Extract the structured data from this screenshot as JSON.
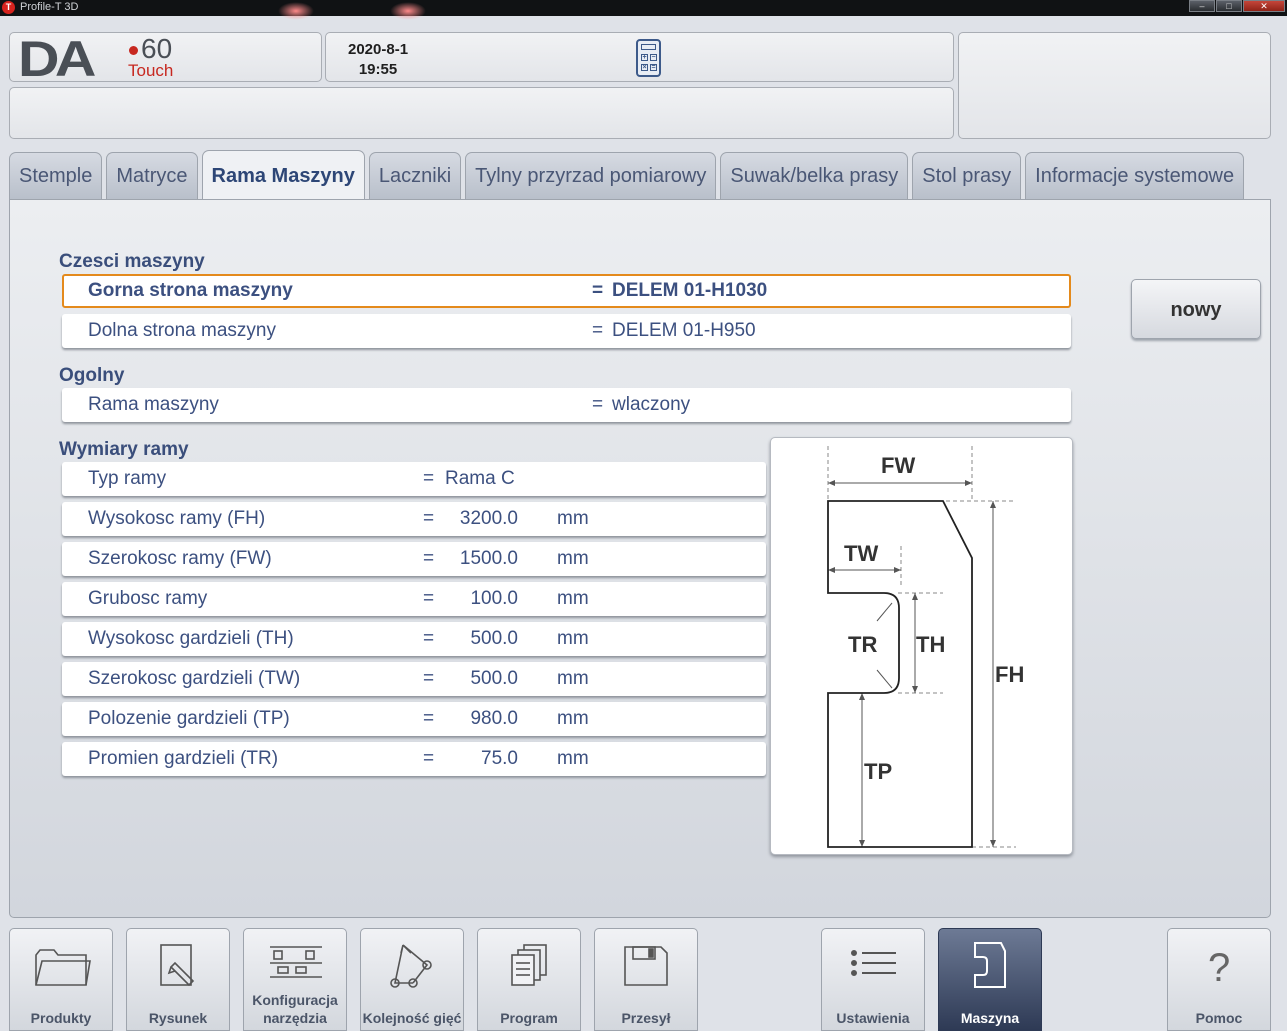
{
  "window": {
    "title": "Profile-T 3D",
    "app_icon": "T"
  },
  "logo": {
    "brand": "DA",
    "model": "60",
    "edition": "Touch"
  },
  "status": {
    "date": "2020-8-1",
    "time": "19:55",
    "calculator_icon": "calculator-icon"
  },
  "tabs": [
    {
      "label": "Stemple"
    },
    {
      "label": "Matryce"
    },
    {
      "label": "Rama Maszyny",
      "active": true
    },
    {
      "label": "Laczniki"
    },
    {
      "label": "Tylny przyrzad pomiarowy"
    },
    {
      "label": "Suwak/belka prasy"
    },
    {
      "label": "Stol prasy"
    },
    {
      "label": "Informacje systemowe"
    }
  ],
  "sections": {
    "parts": {
      "title": "Czesci maszyny",
      "rows": [
        {
          "label": "Gorna strona maszyny",
          "eq": "=",
          "value": "DELEM 01-H1030"
        },
        {
          "label": "Dolna strona maszyny",
          "eq": "=",
          "value": "DELEM 01-H950"
        }
      ]
    },
    "general": {
      "title": "Ogolny",
      "rows": [
        {
          "label": "Rama maszyny",
          "eq": "=",
          "value": "wlaczony"
        }
      ]
    },
    "frame": {
      "title": "Wymiary ramy",
      "rows": [
        {
          "label": "Typ ramy",
          "eq": "=",
          "value": "Rama C",
          "unit": ""
        },
        {
          "label": "Wysokosc ramy (FH)",
          "eq": "=",
          "value": "3200.0",
          "unit": "mm"
        },
        {
          "label": "Szerokosc ramy (FW)",
          "eq": "=",
          "value": "1500.0",
          "unit": "mm"
        },
        {
          "label": "Grubosc ramy",
          "eq": "=",
          "value": "100.0",
          "unit": "mm"
        },
        {
          "label": "Wysokosc gardzieli (TH)",
          "eq": "=",
          "value": "500.0",
          "unit": "mm"
        },
        {
          "label": "Szerokosc gardzieli (TW)",
          "eq": "=",
          "value": "500.0",
          "unit": "mm"
        },
        {
          "label": "Polozenie gardzieli (TP)",
          "eq": "=",
          "value": "980.0",
          "unit": "mm"
        },
        {
          "label": "Promien gardzieli (TR)",
          "eq": "=",
          "value": "75.0",
          "unit": "mm"
        }
      ]
    }
  },
  "new_button": "nowy",
  "diagram_labels": {
    "fw": "FW",
    "tw": "TW",
    "tr": "TR",
    "th": "TH",
    "fh": "FH",
    "tp": "TP"
  },
  "bottom_nav": [
    {
      "label": "Produkty",
      "icon": "folder-icon"
    },
    {
      "label": "Rysunek",
      "icon": "drawing-icon"
    },
    {
      "label": "Konfiguracja narzędzia",
      "icon": "tool-config-icon"
    },
    {
      "label": "Kolejność gięć",
      "icon": "bend-sequence-icon"
    },
    {
      "label": "Program",
      "icon": "program-icon"
    },
    {
      "label": "Przesył",
      "icon": "save-icon"
    },
    {
      "label": "Ustawienia",
      "icon": "settings-list-icon"
    },
    {
      "label": "Maszyna",
      "icon": "machine-icon",
      "active": true
    },
    {
      "label": "Pomoc",
      "icon": "help-icon"
    }
  ]
}
